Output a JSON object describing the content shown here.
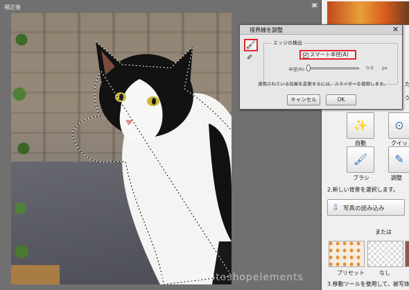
{
  "window": {
    "doc_title": "補正後",
    "close_glyph": "×"
  },
  "dialog": {
    "title": "境界線を調整",
    "close_glyph": "✕",
    "group_label": "エッジの検出",
    "smart_radius_label": "スマート半径(A)",
    "smart_radius_checked": true,
    "radius_label": "半径(R):",
    "radius_value": "0.0",
    "radius_unit": "px",
    "radius_fraction": 0.0,
    "hint": "適用されている効果を変更するには、スライダーを使用します。",
    "cancel_label": "キャンセル",
    "ok_label": "OK",
    "refine_icon": "brush-icon",
    "erase_icon": "eraser-icon"
  },
  "panel": {
    "side_text_1": "た",
    "side_text_2": "ク",
    "tools": [
      {
        "label": "自動",
        "icon": "magic-wand-icon"
      },
      {
        "label": "クイック",
        "icon": "quick-select-icon"
      },
      {
        "label": "ブラシ",
        "icon": "brush-icon"
      },
      {
        "label": "調整",
        "icon": "refine-brush-icon"
      }
    ],
    "step2": "2.新しい背景を選択します。",
    "load_photo_label": "写真の読み込み",
    "or_label": "または",
    "swatches": [
      {
        "label": "プリセット"
      },
      {
        "label": "なし"
      }
    ],
    "step3": "3.移動ツールを使用して、被写体",
    "accent_color": "#e0262c"
  },
  "watermark": "http://photoshopelements"
}
